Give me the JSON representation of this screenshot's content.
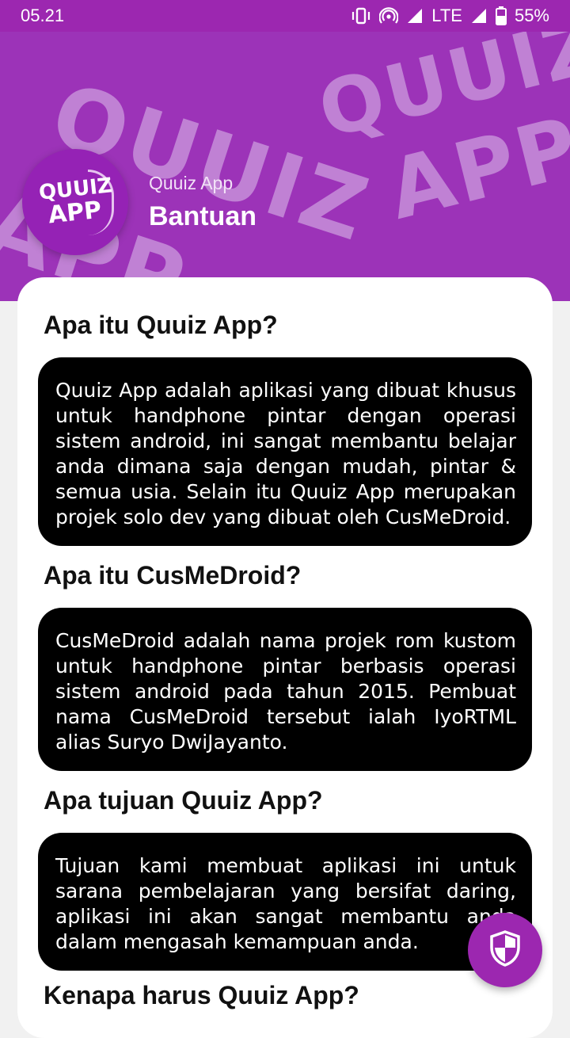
{
  "status_bar": {
    "time": "05.21",
    "network": "LTE",
    "battery": "55%",
    "icons": [
      "vibrate-icon",
      "hotspot-icon",
      "signal-icon",
      "signal-icon",
      "battery-icon"
    ]
  },
  "header": {
    "watermark_line1": "QUUIZ",
    "watermark_line2": "APP",
    "logo_line1": "QUUIZ",
    "logo_line2": "APP",
    "app_name": "Quuiz App",
    "title": "Bantuan"
  },
  "faq": [
    {
      "question": "Apa itu Quuiz App?",
      "answer": "Quuiz App adalah aplikasi yang dibuat khusus untuk handphone pintar dengan operasi sistem android, ini sangat membantu belajar anda dimana saja dengan mudah, pintar & semua usia. Selain itu Quuiz App merupakan projek solo dev yang dibuat oleh CusMeDroid."
    },
    {
      "question": "Apa itu CusMeDroid?",
      "answer": "CusMeDroid adalah nama projek rom kustom untuk handphone pintar berbasis operasi sistem android pada tahun 2015. Pembuat nama CusMeDroid tersebut ialah IyoRTML alias Suryo DwiJayanto."
    },
    {
      "question": "Apa tujuan Quuiz App?",
      "answer": "Tujuan kami membuat aplikasi ini untuk sarana pembelajaran yang bersifat daring, aplikasi ini akan sangat membantu anda dalam mengasah kemampuan anda."
    },
    {
      "question": "Kenapa harus Quuiz App?"
    }
  ],
  "fab": {
    "icon": "shield-icon"
  },
  "colors": {
    "primary": "#9c27b0",
    "header": "#9c33b8",
    "answer_bg": "#000000",
    "card_bg": "#ffffff"
  }
}
